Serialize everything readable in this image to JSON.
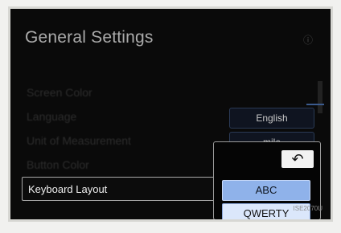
{
  "title": "General Settings",
  "top_right_icon": "info-icon",
  "rows": [
    {
      "label": "Screen Color",
      "value": ""
    },
    {
      "label": "Language",
      "value": "English"
    },
    {
      "label": "Unit of Measurement",
      "value": "mile"
    },
    {
      "label": "Button Color",
      "value": ""
    }
  ],
  "keyboard_layout": {
    "label": "Keyboard Layout",
    "back_icon": "back-arrow-icon",
    "options": [
      "ABC",
      "QWERTY"
    ],
    "selected": "ABC"
  },
  "code": "ISE2070U"
}
